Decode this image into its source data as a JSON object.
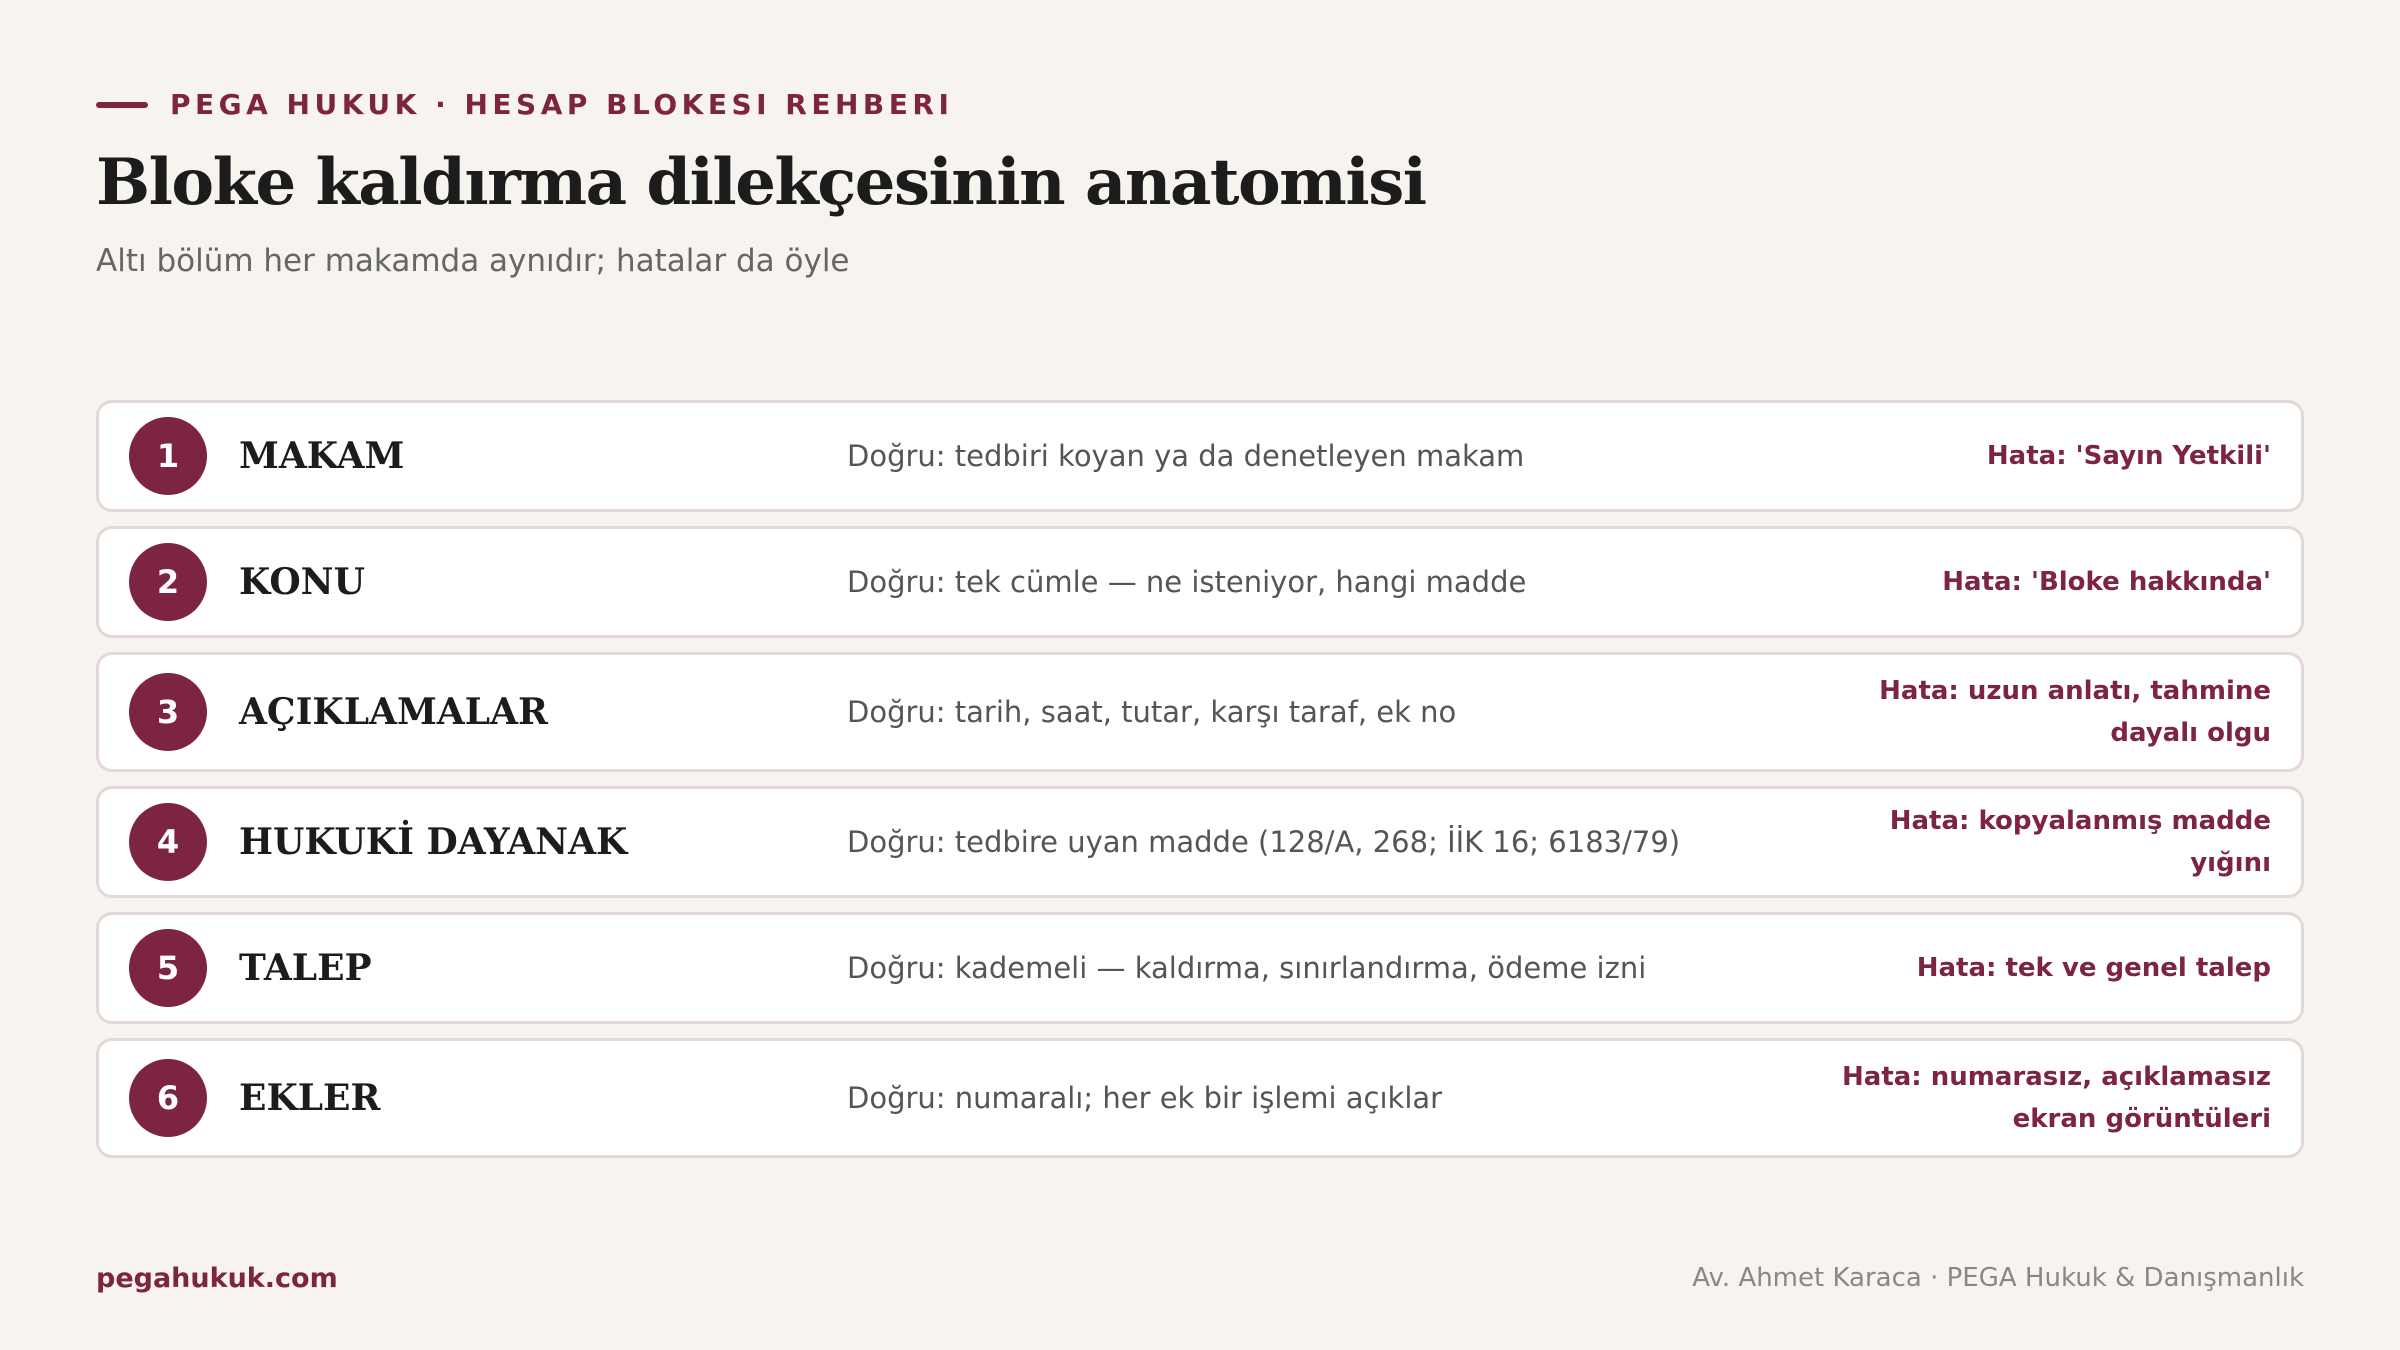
{
  "header": {
    "eyebrow": "PEGA HUKUK · HESAP BLOKESI REHBERI",
    "title": "Bloke kaldırma dilekçesinin anatomisi",
    "subtitle": "Altı bölüm her makamda aynıdır; hatalar da öyle"
  },
  "rows": [
    {
      "number": "1",
      "label": "MAKAM",
      "correct": "Doğru: tedbiri koyan ya da denetleyen makam",
      "error": "Hata: 'Sayın Yetkili'"
    },
    {
      "number": "2",
      "label": "KONU",
      "correct": "Doğru: tek cümle — ne isteniyor, hangi madde",
      "error": "Hata: 'Bloke hakkında'"
    },
    {
      "number": "3",
      "label": "AÇIKLAMALAR",
      "correct": "Doğru: tarih, saat, tutar, karşı taraf, ek no",
      "error": "Hata: uzun anlatı, tahmine dayalı olgu"
    },
    {
      "number": "4",
      "label": "HUKUKİ DAYANAK",
      "correct": "Doğru: tedbire uyan madde (128/A, 268; İİK 16; 6183/79)",
      "error": "Hata: kopyalanmış madde yığını"
    },
    {
      "number": "5",
      "label": "TALEP",
      "correct": "Doğru: kademeli — kaldırma, sınırlandırma, ödeme izni",
      "error": "Hata: tek ve genel talep"
    },
    {
      "number": "6",
      "label": "EKLER",
      "correct": "Doğru: numaralı; her ek bir işlemi açıklar",
      "error": "Hata: numarasız, açıklamasız ekran görüntüleri"
    }
  ],
  "footer": {
    "website": "pegahukuk.com",
    "author": "Av. Ahmet Karaca · PEGA Hukuk & Danışmanlık"
  },
  "colors": {
    "accent": "#7c2440",
    "background": "#f7f4f0",
    "card": "#ffffff",
    "border": "#e2d8d6"
  }
}
